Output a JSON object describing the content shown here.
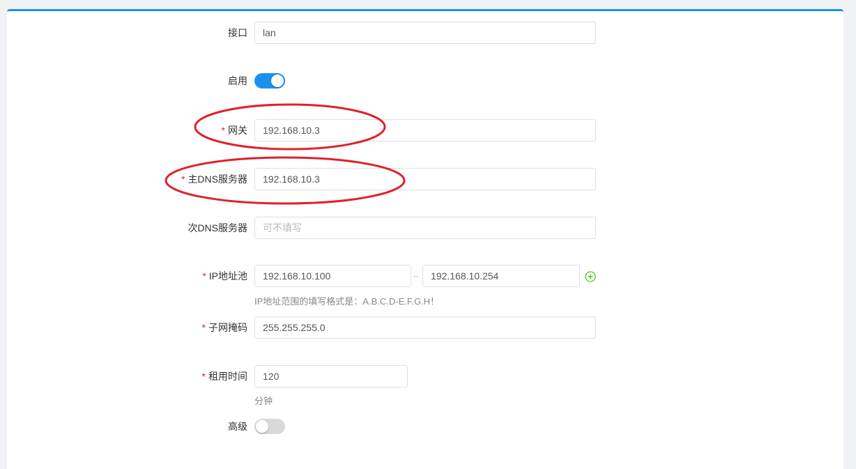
{
  "form": {
    "interface": {
      "label": "接口",
      "value": "lan"
    },
    "enable": {
      "label": "启用",
      "state": "on"
    },
    "gateway": {
      "label": "网关",
      "required": "*",
      "value": "192.168.10.3"
    },
    "primary_dns": {
      "label": "主DNS服务器",
      "required": "*",
      "value": "192.168.10.3"
    },
    "secondary_dns": {
      "label": "次DNS服务器",
      "value": "",
      "placeholder": "可不填写"
    },
    "ip_pool": {
      "label": "IP地址池",
      "required": "*",
      "start": "192.168.10.100",
      "separator": "–",
      "end": "192.168.10.254",
      "hint": "IP地址范围的填写格式是：A.B.C.D-E.F.G.H！"
    },
    "subnet_mask": {
      "label": "子网掩码",
      "required": "*",
      "value": "255.255.255.0"
    },
    "lease_time": {
      "label": "租用时间",
      "required": "*",
      "value": "120",
      "unit": "分钟"
    },
    "advanced": {
      "label": "高级",
      "state": "off"
    }
  },
  "colors": {
    "accent": "#1a91ec",
    "required": "#e02020",
    "annotation": "#e0202a",
    "add_icon": "#52c41a"
  },
  "icons": {
    "add": "plus-circle-icon"
  }
}
